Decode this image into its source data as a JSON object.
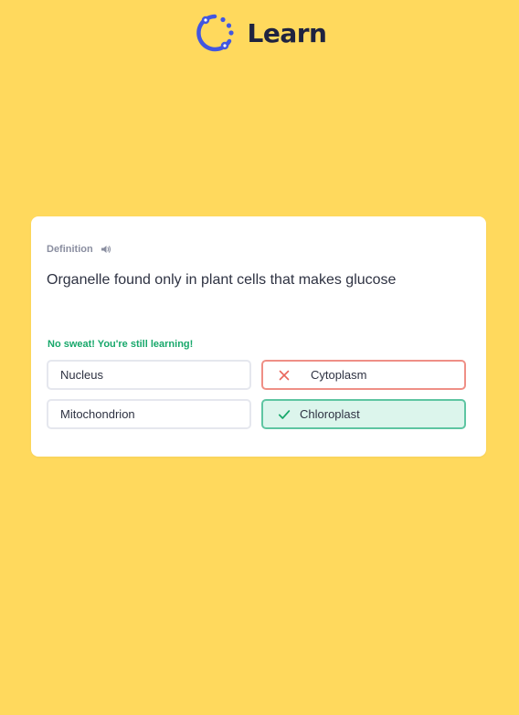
{
  "header": {
    "brand": "Learn",
    "logo_icon": "learn-logo-icon",
    "accent_color": "#4257e0"
  },
  "card": {
    "term_label": "Definition",
    "sound_icon": "speaker-icon",
    "prompt": "Organelle found only in plant cells that makes glucose",
    "feedback": "No sweat! You're still learning!",
    "options": [
      {
        "label": "Nucleus",
        "state": "neutral"
      },
      {
        "label": "Cytoplasm",
        "state": "incorrect",
        "icon": "x-icon"
      },
      {
        "label": "Mitochondrion",
        "state": "neutral"
      },
      {
        "label": "Chloroplast",
        "state": "correct",
        "icon": "check-icon"
      }
    ]
  },
  "colors": {
    "background": "#ffd95d",
    "correct": "#18a86b",
    "incorrect": "#e8665b"
  }
}
